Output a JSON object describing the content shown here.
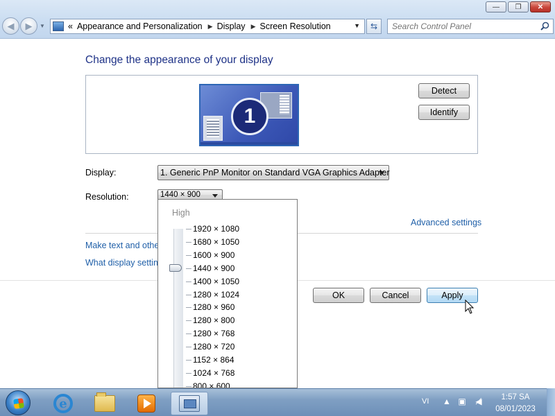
{
  "window": {
    "controls": {
      "minimize": "—",
      "maximize": "❐",
      "close": "✕"
    }
  },
  "nav": {
    "back_icon": "back-arrow-icon",
    "forward_icon": "forward-arrow-icon",
    "breadcrumb": [
      "Appearance and Personalization",
      "Display",
      "Screen Resolution"
    ],
    "overflow": "«",
    "search_placeholder": "Search Control Panel"
  },
  "page": {
    "heading": "Change the appearance of your display",
    "monitor_number": "1",
    "detect_button": "Detect",
    "identify_button": "Identify",
    "display_label": "Display:",
    "display_value": "1. Generic PnP Monitor on Standard VGA Graphics Adapter",
    "resolution_label": "Resolution:",
    "resolution_value": "1440 × 900",
    "advanced_link": "Advanced settings",
    "link_text_size": "Make text and other",
    "link_what_settings": "What display setting",
    "ok_button": "OK",
    "cancel_button": "Cancel",
    "apply_button": "Apply"
  },
  "resolution_dropdown": {
    "high_label": "High",
    "selected": "1440 × 900",
    "options": [
      "1920 × 1080",
      "1680 × 1050",
      "1600 × 900",
      "1440 × 900",
      "1400 × 1050",
      "1280 × 1024",
      "1280 × 960",
      "1280 × 800",
      "1280 × 768",
      "1280 × 720",
      "1152 × 864",
      "1024 × 768",
      "800 × 600"
    ]
  },
  "taskbar": {
    "language": "VI",
    "time": "1:57 SA",
    "date": "08/01/2023"
  },
  "colors": {
    "heading": "#1e3287",
    "link": "#1f5fa8",
    "taskbar": "#7f9fc3"
  }
}
